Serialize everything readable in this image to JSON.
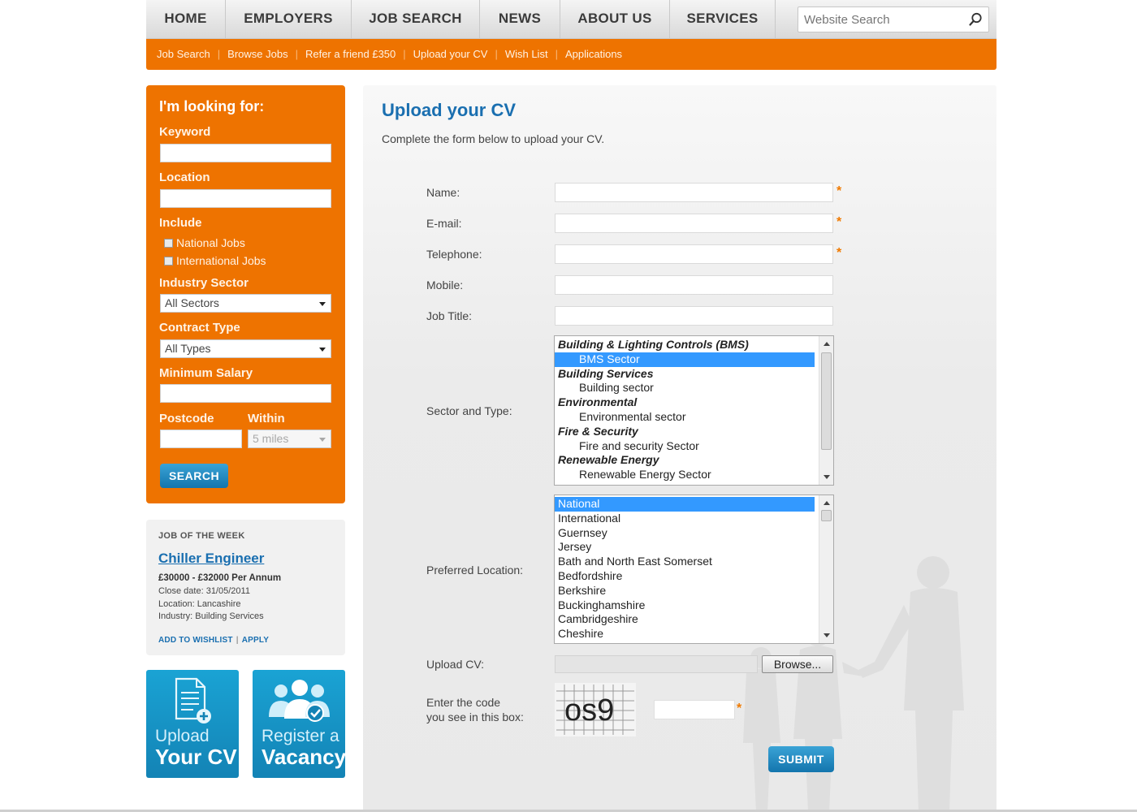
{
  "top_nav": {
    "items": [
      "HOME",
      "EMPLOYERS",
      "JOB SEARCH",
      "NEWS",
      "ABOUT US",
      "SERVICES"
    ],
    "search_placeholder": "Website Search",
    "search_icon": "magnifier-icon"
  },
  "sub_nav": {
    "links": [
      "Job Search",
      "Browse Jobs",
      "Refer a friend £350",
      "Upload your CV",
      "Wish List",
      "Applications"
    ],
    "separator": "|"
  },
  "sidebar_search": {
    "title": "I'm looking for:",
    "keyword_label": "Keyword",
    "location_label": "Location",
    "include_label": "Include",
    "include_options": [
      "National Jobs",
      "International Jobs"
    ],
    "industry_label": "Industry Sector",
    "industry_value": "All Sectors",
    "contract_label": "Contract Type",
    "contract_value": "All Types",
    "salary_label": "Minimum Salary",
    "postcode_label": "Postcode",
    "within_label": "Within",
    "within_value": "5 miles",
    "search_button": "SEARCH"
  },
  "job_of_week": {
    "heading": "JOB OF THE WEEK",
    "title": "Chiller Engineer",
    "salary": "£30000 - £32000 Per Annum",
    "close_date": "Close date: 31/05/2011",
    "location": "Location: Lancashire",
    "industry": "Industry: Building Services",
    "add_wishlist": "ADD TO WISHLIST",
    "apply": "APPLY",
    "separator": "|"
  },
  "promos": {
    "upload": {
      "line1": "Upload",
      "line2": "Your CV",
      "icon": "document-add-icon"
    },
    "register": {
      "line1": "Register a",
      "line2": "Vacancy",
      "icon": "people-check-icon"
    }
  },
  "form": {
    "heading": "Upload your CV",
    "intro": "Complete the form below to upload your CV.",
    "required_mark": "*",
    "fields": {
      "name": "Name:",
      "email": "E-mail:",
      "telephone": "Telephone:",
      "mobile": "Mobile:",
      "job_title": "Job Title:",
      "sector": "Sector and Type:",
      "location": "Preferred Location:",
      "upload": "Upload CV:",
      "captcha_line1": "Enter the code",
      "captcha_line2": "you see in this box:"
    },
    "sector_options": [
      {
        "text": "Building & Lighting Controls (BMS)",
        "kind": "group"
      },
      {
        "text": "BMS Sector",
        "kind": "item",
        "selected": true
      },
      {
        "text": "Building Services",
        "kind": "group"
      },
      {
        "text": "Building sector",
        "kind": "item"
      },
      {
        "text": "Environmental",
        "kind": "group"
      },
      {
        "text": "Environmental sector",
        "kind": "item"
      },
      {
        "text": "Fire & Security",
        "kind": "group"
      },
      {
        "text": "Fire and security Sector",
        "kind": "item"
      },
      {
        "text": "Renewable Energy",
        "kind": "group"
      },
      {
        "text": "Renewable Energy Sector",
        "kind": "item"
      }
    ],
    "location_options": [
      {
        "text": "National",
        "selected": true
      },
      {
        "text": "International"
      },
      {
        "text": "Guernsey"
      },
      {
        "text": "Jersey"
      },
      {
        "text": "Bath and North East Somerset"
      },
      {
        "text": "Bedfordshire"
      },
      {
        "text": "Berkshire"
      },
      {
        "text": "Buckinghamshire"
      },
      {
        "text": "Cambridgeshire"
      },
      {
        "text": "Cheshire"
      }
    ],
    "browse_button": "Browse...",
    "captcha_text": "os9",
    "submit_button": "SUBMIT"
  },
  "colors": {
    "brand_orange": "#ee7300",
    "link_blue": "#1a6fb0",
    "button_blue": "#1a8cc4",
    "selection_blue": "#3399ff"
  }
}
